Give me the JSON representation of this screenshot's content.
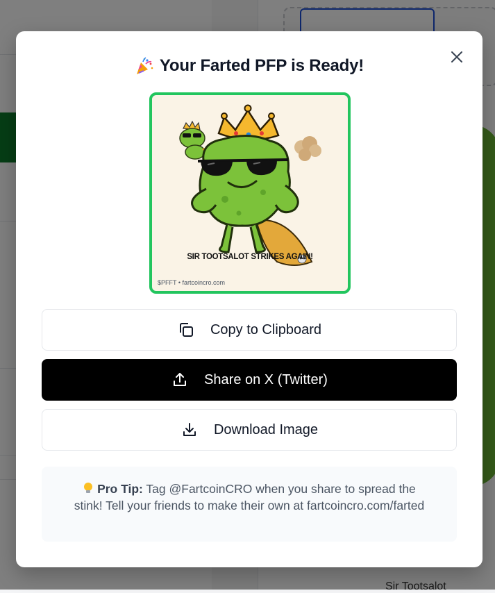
{
  "modal": {
    "title": "Your Farted PFP is Ready!",
    "title_icon": "party-popper-icon",
    "close_icon": "close-icon"
  },
  "pfp": {
    "caption": "SIR TOOTSALOT STRIKES AGAIN!",
    "watermark": "$PFFT • fartcoincro.com"
  },
  "actions": {
    "copy": {
      "label": "Copy to Clipboard",
      "icon": "copy-icon"
    },
    "share": {
      "label": "Share on X (Twitter)",
      "icon": "share-icon"
    },
    "download": {
      "label": "Download Image",
      "icon": "download-icon"
    }
  },
  "tip": {
    "icon": "lightbulb-icon",
    "label": "Pro Tip:",
    "text": "Tag @FartcoinCRO when you share to spread the stink! Tell your friends to make their own at fartcoincro.com/farted"
  },
  "background": {
    "partial_text": "Sir Tootsalot"
  },
  "colors": {
    "accent_green": "#22c55e",
    "share_button": "#000000",
    "overlay": "rgba(0,0,0,0.5)"
  }
}
